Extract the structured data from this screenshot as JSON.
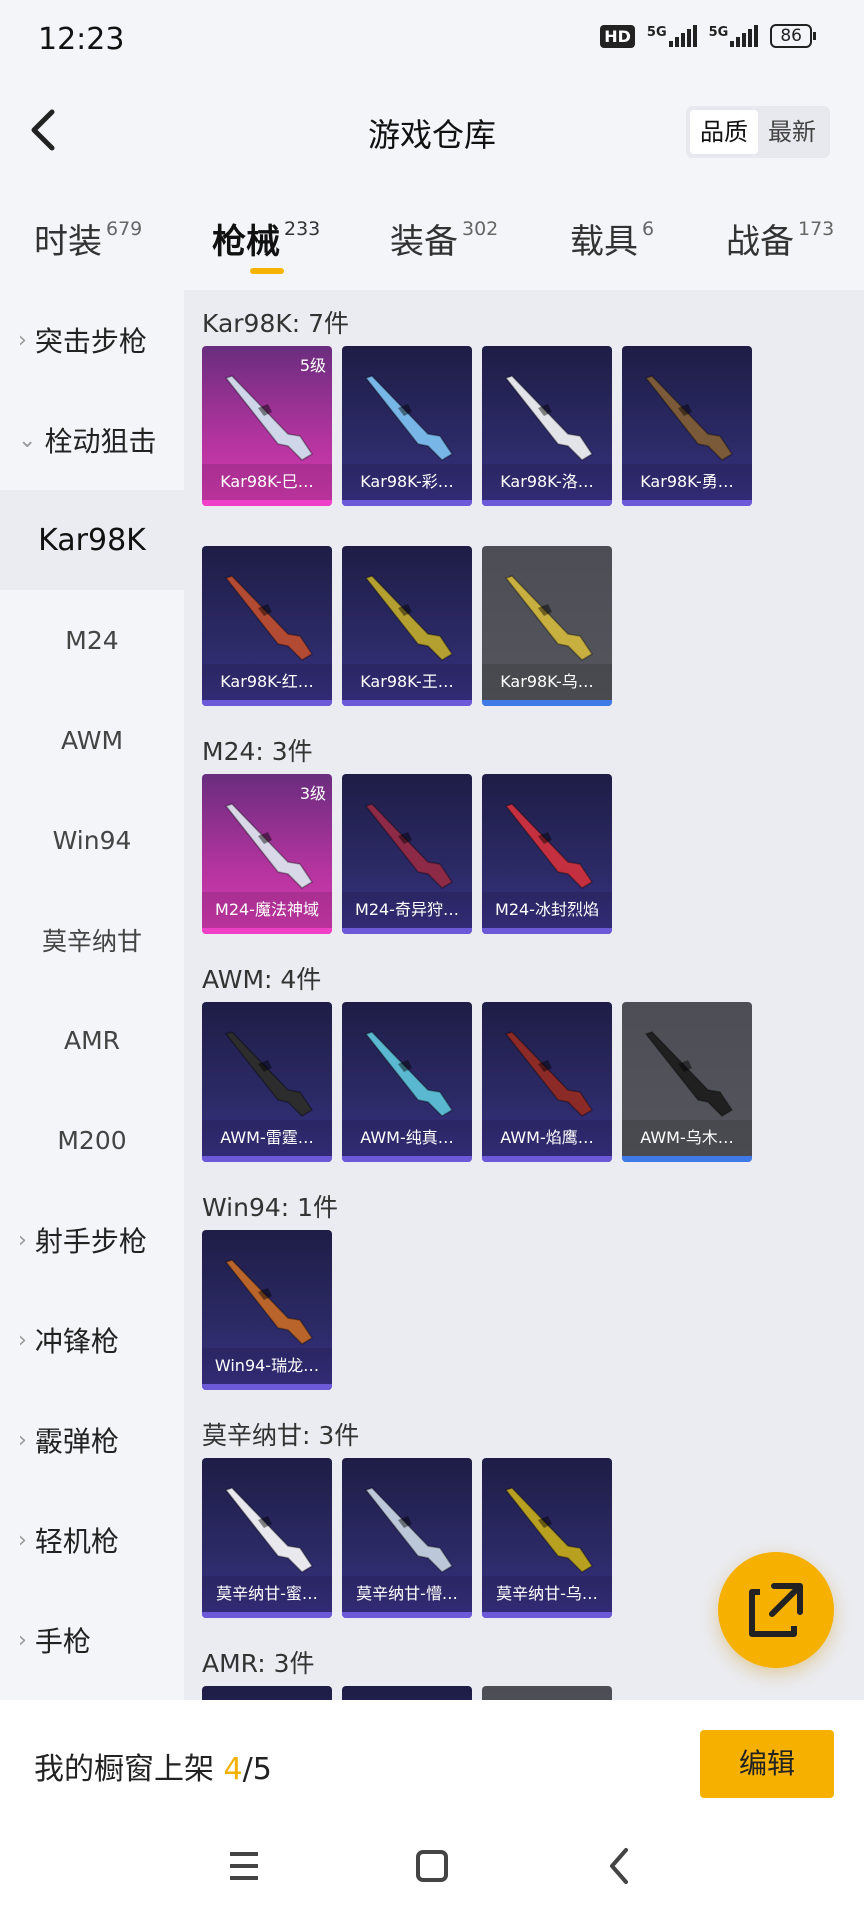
{
  "status": {
    "time": "12:23",
    "hd": "HD",
    "net1": "5G",
    "net2": "5G",
    "battery": "86"
  },
  "header": {
    "title": "游戏仓库",
    "sort": [
      "品质",
      "最新"
    ]
  },
  "tabs": [
    {
      "label": "时装",
      "count": "679"
    },
    {
      "label": "枪械",
      "count": "233"
    },
    {
      "label": "装备",
      "count": "302"
    },
    {
      "label": "载具",
      "count": "6"
    },
    {
      "label": "战备",
      "count": "173"
    }
  ],
  "sidebar": [
    "突击步枪",
    "栓动狙击",
    "Kar98K",
    "M24",
    "AWM",
    "Win94",
    "莫辛纳甘",
    "AMR",
    "M200",
    "射手步枪",
    "冲锋枪",
    "霰弹枪",
    "轻机枪",
    "手枪"
  ],
  "sections": [
    {
      "title": "Kar98K: 7件",
      "items": [
        {
          "name": "Kar98K-巳…",
          "level": "5级",
          "rarity": "purple"
        },
        {
          "name": "Kar98K-彩…",
          "rarity": "blue"
        },
        {
          "name": "Kar98K-洛…",
          "rarity": "blue"
        },
        {
          "name": "Kar98K-勇…",
          "rarity": "blue"
        },
        {
          "name": "Kar98K-红…",
          "rarity": "blue"
        },
        {
          "name": "Kar98K-王…",
          "rarity": "blue"
        },
        {
          "name": "Kar98K-乌…",
          "rarity": "grey"
        }
      ]
    },
    {
      "title": "M24: 3件",
      "items": [
        {
          "name": "M24-魔法神域",
          "level": "3级",
          "rarity": "purple"
        },
        {
          "name": "M24-奇异狩…",
          "rarity": "blue"
        },
        {
          "name": "M24-冰封烈焰",
          "rarity": "blue"
        }
      ]
    },
    {
      "title": "AWM: 4件",
      "items": [
        {
          "name": "AWM-雷霆…",
          "rarity": "blue"
        },
        {
          "name": "AWM-纯真…",
          "rarity": "blue"
        },
        {
          "name": "AWM-焰鹰…",
          "rarity": "blue"
        },
        {
          "name": "AWM-乌木…",
          "rarity": "grey"
        }
      ]
    },
    {
      "title": "Win94: 1件",
      "items": [
        {
          "name": "Win94-瑞龙…",
          "rarity": "blue"
        }
      ]
    },
    {
      "title": "莫辛纳甘: 3件",
      "items": [
        {
          "name": "莫辛纳甘-蜜…",
          "rarity": "blue"
        },
        {
          "name": "莫辛纳甘-懵…",
          "rarity": "blue"
        },
        {
          "name": "莫辛纳甘-乌…",
          "rarity": "blue"
        }
      ]
    },
    {
      "title": "AMR: 3件",
      "items": []
    }
  ],
  "bottom": {
    "label": "我的橱窗上架",
    "current": "4",
    "total": "/5",
    "edit": "编辑"
  },
  "colors": {
    "accent": "#f6b000"
  }
}
